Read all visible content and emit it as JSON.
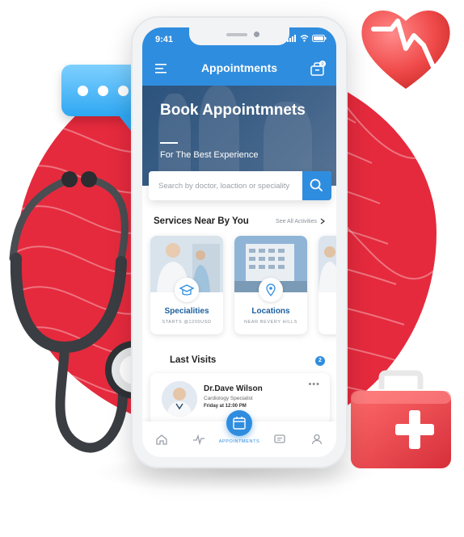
{
  "status": {
    "time": "9:41"
  },
  "appbar": {
    "title": "Appointments",
    "menu_icon": "hamburger-menu-icon",
    "bag_icon": "medical-bag-icon",
    "badge": "0"
  },
  "hero": {
    "title": "Book Appointmnets",
    "subtitle": "For The Best Experience"
  },
  "search": {
    "placeholder": "Search by doctor, loaction or speciality",
    "value": ""
  },
  "services": {
    "heading": "Services Near By You",
    "see_all": "See All Activities",
    "cards": [
      {
        "label": "Specialities",
        "small": "STARTS @1200USD",
        "icon": "doctor-cap-icon"
      },
      {
        "label": "Locations",
        "small": "NEAR BEVERY HILLS",
        "icon": "location-pin-icon"
      }
    ]
  },
  "last_visits": {
    "heading": "Last Visits",
    "count": "2",
    "items": [
      {
        "name": "Dr.Dave Wilson",
        "role": "Cardiology Specialist",
        "when": "Friday at 12:00 PM"
      }
    ]
  },
  "tabbar": {
    "active_label": "APPOINTMENTS",
    "tabs": [
      "home-icon",
      "activity-icon",
      "appointments-icon",
      "messages-icon",
      "profile-icon"
    ]
  },
  "colors": {
    "primary": "#2f8ddf",
    "accent_red": "#e52a3d",
    "chat_blue": "#2ea7f2"
  }
}
